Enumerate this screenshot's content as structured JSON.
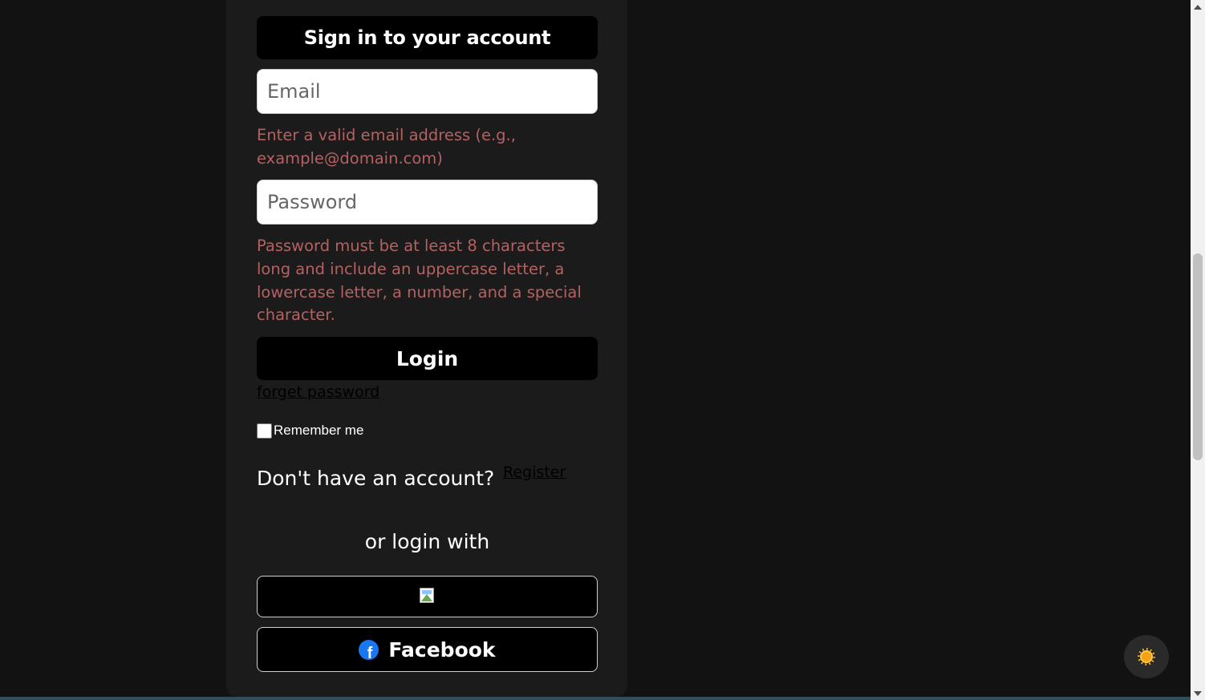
{
  "form": {
    "title": "Sign in to your account",
    "email_placeholder": "Email",
    "email_error": "Enter a valid email address (e.g., example@domain.com)",
    "password_placeholder": "Password",
    "password_error": "Password must be at least 8 characters long and include an uppercase letter, a lowercase letter, a number, and a special character.",
    "login_label": "Login",
    "forget_password_label": "forget password",
    "remember_me_label": "Remember me",
    "no_account_text": "Don't have an account?",
    "register_label": "Register",
    "or_login_with": "or login with",
    "facebook_label": "Facebook"
  },
  "icons": {
    "google": "broken-image-icon",
    "facebook": "facebook-icon",
    "theme": "sun-icon"
  },
  "colors": {
    "background": "#121212",
    "card": "#1b1b1b",
    "error": "#b66161",
    "facebook_blue": "#1877f2",
    "sun": "#f4a11a"
  }
}
